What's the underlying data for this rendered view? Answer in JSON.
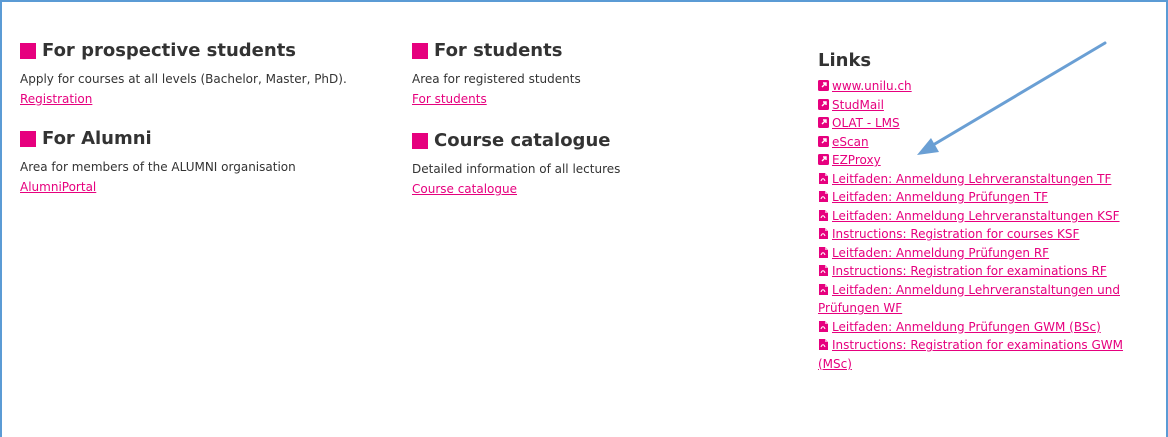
{
  "sections": {
    "prospective": {
      "title": "For prospective students",
      "desc": "Apply for courses at all levels (Bachelor, Master, PhD).",
      "link": "Registration"
    },
    "alumni": {
      "title": "For Alumni",
      "desc": "Area for members of the ALUMNI organisation",
      "link": "AlumniPortal"
    },
    "students": {
      "title": "For students",
      "desc": "Area for registered students",
      "link": "For students"
    },
    "catalogue": {
      "title": "Course catalogue",
      "desc": "Detailed information of all lectures",
      "link": "Course catalogue"
    }
  },
  "links": {
    "title": "Links",
    "items": [
      {
        "label": "www.unilu.ch",
        "icon": "external-link-icon"
      },
      {
        "label": "StudMail",
        "icon": "external-link-icon"
      },
      {
        "label": "OLAT - LMS",
        "icon": "external-link-icon"
      },
      {
        "label": "eScan",
        "icon": "external-link-icon"
      },
      {
        "label": "EZProxy",
        "icon": "external-link-icon"
      },
      {
        "label": "Leitfaden: Anmeldung Lehrveranstaltungen TF",
        "icon": "pdf-icon"
      },
      {
        "label": "Leitfaden: Anmeldung Prüfungen TF",
        "icon": "pdf-icon"
      },
      {
        "label": "Leitfaden: Anmeldung Lehrveranstaltungen KSF",
        "icon": "pdf-icon"
      },
      {
        "label": "Instructions: Registration for courses KSF",
        "icon": "pdf-icon"
      },
      {
        "label": "Leitfaden: Anmeldung Prüfungen RF",
        "icon": "pdf-icon"
      },
      {
        "label": "Instructions: Registration for examinations RF",
        "icon": "pdf-icon"
      },
      {
        "label": "Leitfaden: Anmeldung Lehrveranstaltungen und Prüfungen WF",
        "icon": "pdf-icon"
      },
      {
        "label": "Leitfaden: Anmeldung Prüfungen GWM (BSc)",
        "icon": "pdf-icon"
      },
      {
        "label": "Instructions: Registration for examinations GWM (MSc)",
        "icon": "pdf-icon"
      }
    ]
  },
  "colors": {
    "accent": "#e6007e",
    "frame": "#5b9bd5",
    "arrow": "#6a9fd4"
  }
}
